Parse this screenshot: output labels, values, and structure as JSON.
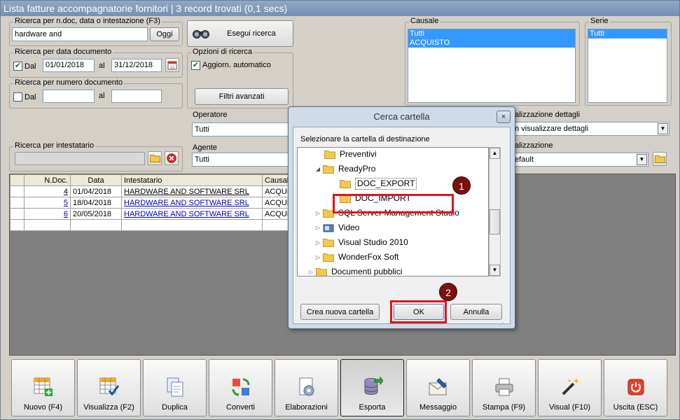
{
  "window": {
    "title": "Lista fatture accompagnatorie fornitori | 3 record trovati (0,1 secs)"
  },
  "search_ndoc": {
    "title": "Ricerca per n.doc, data o intestazione (F3)",
    "value": "hardware and",
    "today_label": "Oggi"
  },
  "search_button": {
    "label": "Esegui ricerca"
  },
  "search_date": {
    "title": "Ricerca per data documento",
    "dal_label": "Dal",
    "from": "01/01/2018",
    "al_label": "al",
    "to": "31/12/2018"
  },
  "search_number": {
    "title": "Ricerca per numero documento",
    "dal_label": "Dal",
    "al_label": "al",
    "from": "",
    "to": ""
  },
  "search_options": {
    "title": "Opzioni di ricerca",
    "auto_update_label": "Aggiorn. automatico",
    "advanced_filters_label": "Filtri avanzati"
  },
  "operator": {
    "label": "Operatore",
    "value": "Tutti"
  },
  "agent": {
    "label": "Agente",
    "value": "Tutti"
  },
  "search_holder": {
    "title": "Ricerca per intestatario",
    "value": ""
  },
  "causale": {
    "title": "Causale",
    "options": [
      "Tutti",
      "ACQUISTO"
    ]
  },
  "serie": {
    "title": "Serie",
    "options": [
      "Tutti"
    ]
  },
  "details_view": {
    "label": "ualizzazione dettagli",
    "value": "n visualizzare dettagli"
  },
  "view": {
    "label": "ualizzazione",
    "value": "efault"
  },
  "grid": {
    "columns": [
      "N.Doc.",
      "Data",
      "Intestatario",
      "Causale"
    ],
    "rows": [
      {
        "ndoc": "4",
        "date": "01/04/2018",
        "holder": "HARDWARE AND SOFTWARE SRL",
        "causale": "ACQUI"
      },
      {
        "ndoc": "5",
        "date": "18/04/2018",
        "holder": "HARDWARE AND SOFTWARE SRL",
        "causale": "ACQUI"
      },
      {
        "ndoc": "6",
        "date": "20/05/2018",
        "holder": "HARDWARE AND SOFTWARE SRL",
        "causale": "ACQUI"
      }
    ]
  },
  "toolbar": {
    "new": "Nuovo (F4)",
    "view": "Visualizza (F2)",
    "duplicate": "Duplica",
    "convert": "Converti",
    "processing": "Elaborazioni",
    "export": "Esporta",
    "message": "Messaggio",
    "print": "Stampa (F9)",
    "visual": "Visual (F10)",
    "exit": "Uscita (ESC)"
  },
  "dialog": {
    "title": "Cerca cartella",
    "close": "×",
    "instruction": "Selezionare la cartella di destinazione",
    "tree": [
      "Preventivi",
      "ReadyPro",
      "DOC_EXPORT",
      "DOC_IMPORT",
      "SQL Server Management Studio",
      "Video",
      "Visual Studio 2010",
      "WonderFox Soft",
      "Documenti pubblici"
    ],
    "new_folder": "Crea nuova cartella",
    "ok": "OK",
    "cancel": "Annulla",
    "badge1": "1",
    "badge2": "2"
  },
  "colors": {
    "title_bar": "#7f9bbd",
    "selection": "#3399ff",
    "highlight": "#e0141e",
    "badge": "#7a1010",
    "link": "#0000cc"
  }
}
